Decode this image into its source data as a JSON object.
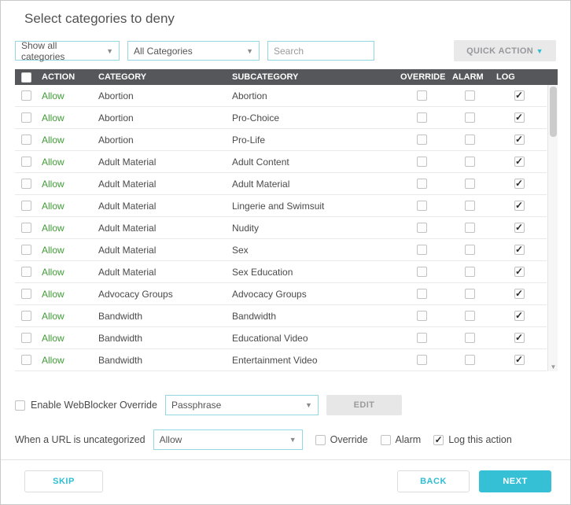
{
  "title": "Select categories to deny",
  "filters": {
    "show_categories": "Show all categories",
    "all_categories": "All Categories",
    "search_placeholder": "Search",
    "quick_action": "QUICK ACTION"
  },
  "table": {
    "headers": {
      "action": "ACTION",
      "category": "CATEGORY",
      "subcategory": "SUBCATEGORY",
      "override": "OVERRIDE",
      "alarm": "ALARM",
      "log": "LOG"
    },
    "select_all_checked": false,
    "rows": [
      {
        "action": "Allow",
        "category": "Abortion",
        "subcategory": "Abortion",
        "override": false,
        "alarm": false,
        "log": true
      },
      {
        "action": "Allow",
        "category": "Abortion",
        "subcategory": "Pro-Choice",
        "override": false,
        "alarm": false,
        "log": true
      },
      {
        "action": "Allow",
        "category": "Abortion",
        "subcategory": "Pro-Life",
        "override": false,
        "alarm": false,
        "log": true
      },
      {
        "action": "Allow",
        "category": "Adult Material",
        "subcategory": "Adult Content",
        "override": false,
        "alarm": false,
        "log": true
      },
      {
        "action": "Allow",
        "category": "Adult Material",
        "subcategory": "Adult Material",
        "override": false,
        "alarm": false,
        "log": true
      },
      {
        "action": "Allow",
        "category": "Adult Material",
        "subcategory": "Lingerie and Swimsuit",
        "override": false,
        "alarm": false,
        "log": true
      },
      {
        "action": "Allow",
        "category": "Adult Material",
        "subcategory": "Nudity",
        "override": false,
        "alarm": false,
        "log": true
      },
      {
        "action": "Allow",
        "category": "Adult Material",
        "subcategory": "Sex",
        "override": false,
        "alarm": false,
        "log": true
      },
      {
        "action": "Allow",
        "category": "Adult Material",
        "subcategory": "Sex Education",
        "override": false,
        "alarm": false,
        "log": true
      },
      {
        "action": "Allow",
        "category": "Advocacy Groups",
        "subcategory": "Advocacy Groups",
        "override": false,
        "alarm": false,
        "log": true
      },
      {
        "action": "Allow",
        "category": "Bandwidth",
        "subcategory": "Bandwidth",
        "override": false,
        "alarm": false,
        "log": true
      },
      {
        "action": "Allow",
        "category": "Bandwidth",
        "subcategory": "Educational Video",
        "override": false,
        "alarm": false,
        "log": true
      },
      {
        "action": "Allow",
        "category": "Bandwidth",
        "subcategory": "Entertainment Video",
        "override": false,
        "alarm": false,
        "log": true
      }
    ]
  },
  "webblocker_override": {
    "label": "Enable WebBlocker Override",
    "enabled": false,
    "method": "Passphrase",
    "edit_button": "EDIT"
  },
  "uncategorized": {
    "label": "When a URL is uncategorized",
    "action": "Allow",
    "override_label": "Override",
    "override_checked": false,
    "alarm_label": "Alarm",
    "alarm_checked": false,
    "log_label": "Log this action",
    "log_checked": true
  },
  "footer": {
    "skip": "SKIP",
    "back": "BACK",
    "next": "NEXT"
  },
  "colors": {
    "accent": "#2fbdd2",
    "table_header_bg": "#55575b",
    "allow_green": "#3f9c35"
  }
}
